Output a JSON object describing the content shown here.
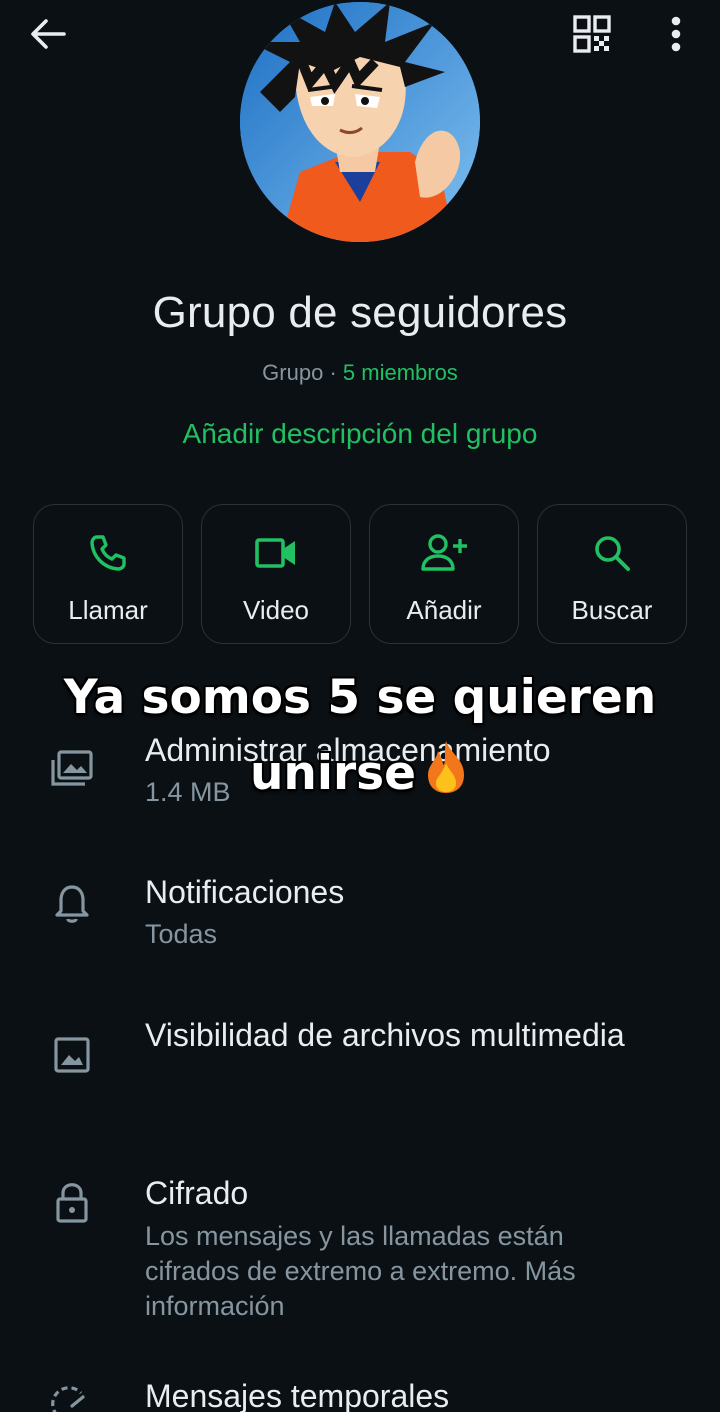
{
  "header": {
    "back_icon": "arrow-left-icon",
    "qr_icon": "qr-code-icon",
    "more_icon": "more-vertical-icon"
  },
  "group": {
    "name": "Grupo de seguidores",
    "type": "Grupo",
    "separator": " · ",
    "members": "5 miembros",
    "add_description": "Añadir descripción del grupo"
  },
  "actions": [
    {
      "label": "Llamar",
      "icon": "phone-icon"
    },
    {
      "label": "Video",
      "icon": "video-icon"
    },
    {
      "label": "Añadir",
      "icon": "add-person-icon"
    },
    {
      "label": "Buscar",
      "icon": "search-icon"
    }
  ],
  "caption": {
    "line1": "Ya somos 5 se quieren",
    "line2": "unirse",
    "emoji": "fire-emoji"
  },
  "settings": [
    {
      "title": "Administrar almacenamiento",
      "subtitle": "1.4 MB",
      "icon": "storage-icon"
    },
    {
      "title": "Notificaciones",
      "subtitle": "Todas",
      "icon": "bell-icon"
    },
    {
      "title": "Visibilidad de archivos multimedia",
      "subtitle": "",
      "icon": "image-icon"
    },
    {
      "title": "Cifrado",
      "subtitle": "Los mensajes y las llamadas están cifrados de extremo a extremo. Más información",
      "icon": "lock-icon"
    },
    {
      "title": "Mensajes temporales",
      "subtitle": "",
      "icon": "timer-icon"
    }
  ],
  "colors": {
    "background": "#0b1014",
    "accent": "#21c063",
    "secondary_text": "#8696a0",
    "primary_text": "#e9edef"
  }
}
